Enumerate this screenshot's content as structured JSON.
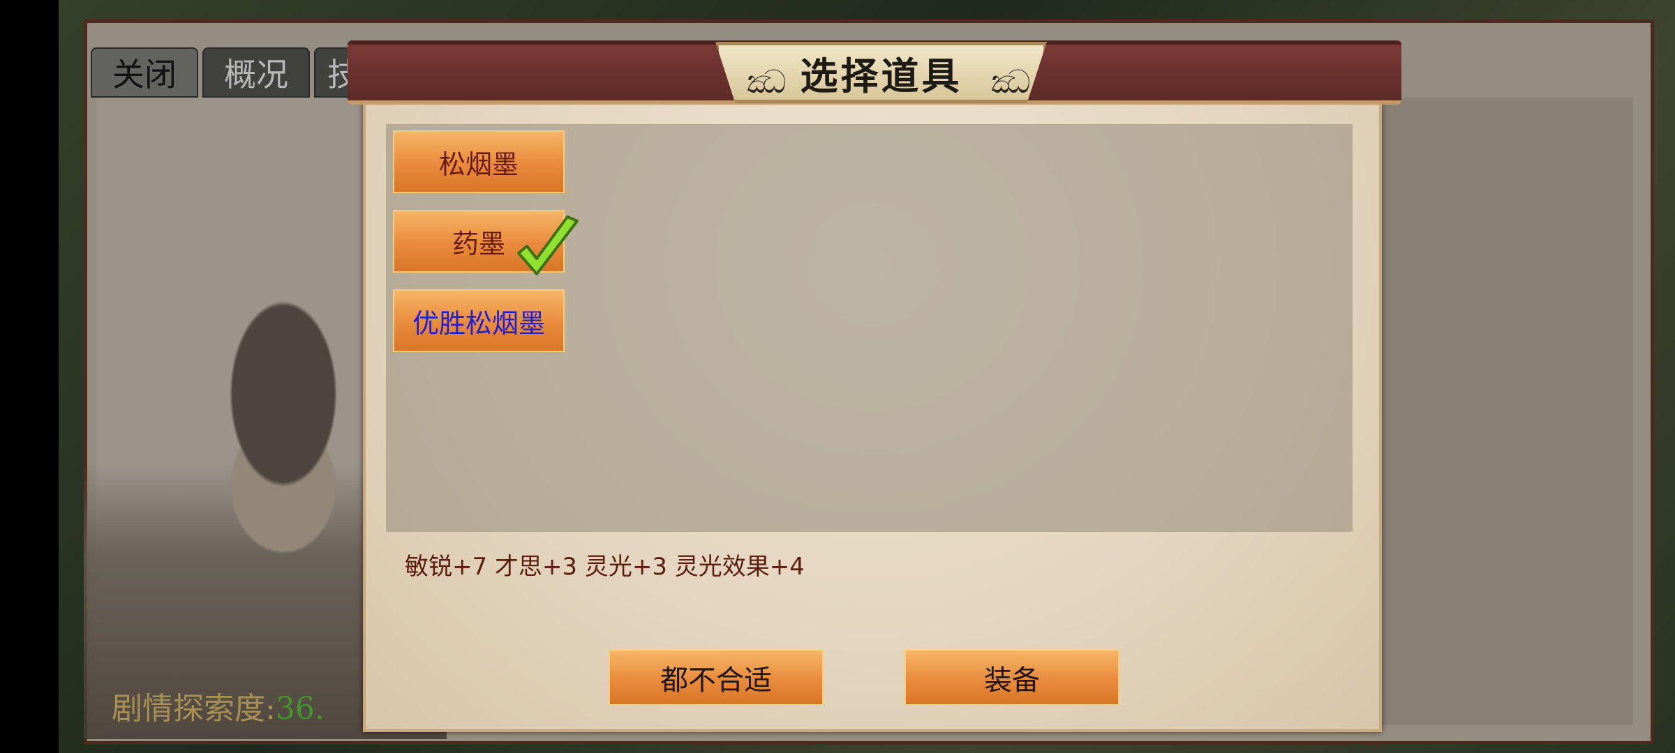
{
  "background": {
    "tabs": [
      "关闭",
      "概况",
      "技"
    ],
    "story_label": "剧情探索度:",
    "story_value": "36."
  },
  "dialog": {
    "title": "选择道具",
    "items": [
      {
        "label": "松烟墨",
        "color": "#6a1a0c",
        "selected": false
      },
      {
        "label": "药墨",
        "color": "#6a1a0c",
        "selected": true
      },
      {
        "label": "优胜松烟墨",
        "color": "#1f1fd8",
        "selected": false
      }
    ],
    "description": "敏锐+7 才思+3 灵光+3 灵光效果+4",
    "buttons": {
      "none_suitable": "都不合适",
      "equip": "装备"
    }
  },
  "icons": {
    "selected_mark": "check-icon",
    "title_ornament": "swirl-ornament"
  },
  "colors": {
    "button_orange": "#e98a3c",
    "header_maroon": "#6a302c",
    "check_green": "#7fd12a"
  }
}
